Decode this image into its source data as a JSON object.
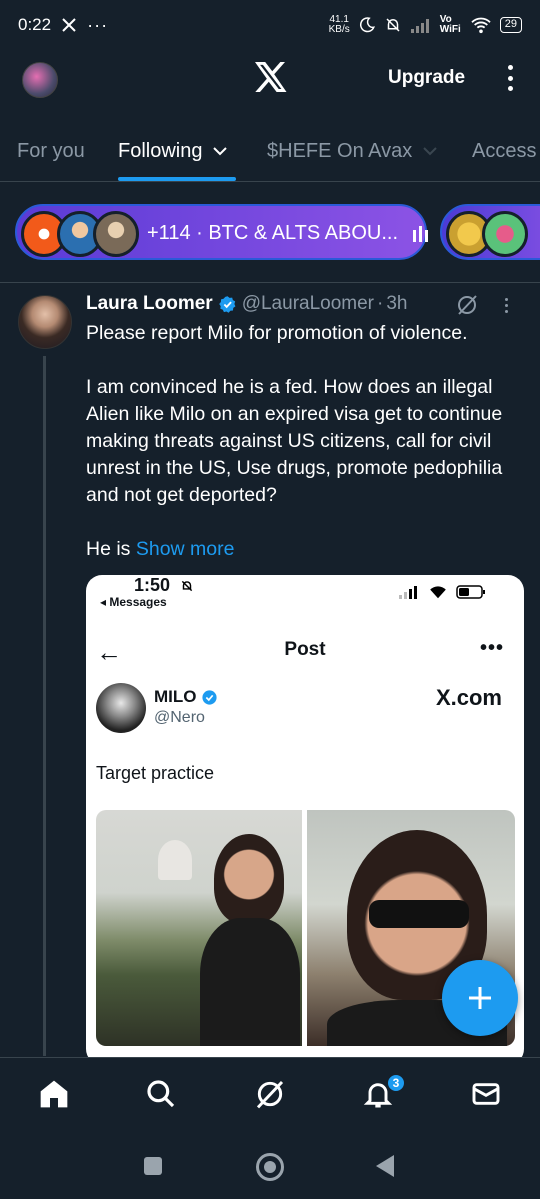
{
  "status_bar": {
    "time": "0:22",
    "speed": "41.1",
    "speed_unit": "KB/s",
    "network": "Vo WiFi",
    "battery": "29"
  },
  "header": {
    "upgrade_label": "Upgrade"
  },
  "tabs": [
    {
      "label": "For you",
      "active": false
    },
    {
      "label": "Following",
      "active": true
    },
    {
      "label": "$HEFE On Avax",
      "active": false
    },
    {
      "label": "Access",
      "active": false
    }
  ],
  "spaces": {
    "title": "+114 · BTC & ALTS ABOU..."
  },
  "tweet": {
    "name": "Laura Loomer",
    "handle": "@LauraLoomer",
    "sep": "·",
    "time": "3h",
    "line1": "Please report Milo for promotion of violence.",
    "para2": "I am convinced he is a fed. How does an illegal Alien like Milo on an expired visa get to continue making threats against US citizens, call for civil unrest in the US, Use drugs, promote pedophilia and not get deported?",
    "para3_prefix": "He is ",
    "show_more": "Show more"
  },
  "embed": {
    "time": "1:50",
    "back_label": "◂ Messages",
    "title": "Post",
    "name": "MILO",
    "handle": "@Nero",
    "brand": "X.com",
    "text": "Target practice"
  },
  "bottom_nav": {
    "notif_count": "3"
  },
  "colors": {
    "background": "#15202b",
    "accent": "#1d9bf0",
    "spaces_gradient_start": "#5b3bd6",
    "spaces_gradient_end": "#8c53e5"
  },
  "icons": [
    "x-logo-icon",
    "more-vert-icon",
    "chevron-down-icon",
    "verified-icon",
    "grok-icon",
    "plus-icon",
    "home-icon",
    "search-icon",
    "notification-bell-icon",
    "mail-icon"
  ]
}
